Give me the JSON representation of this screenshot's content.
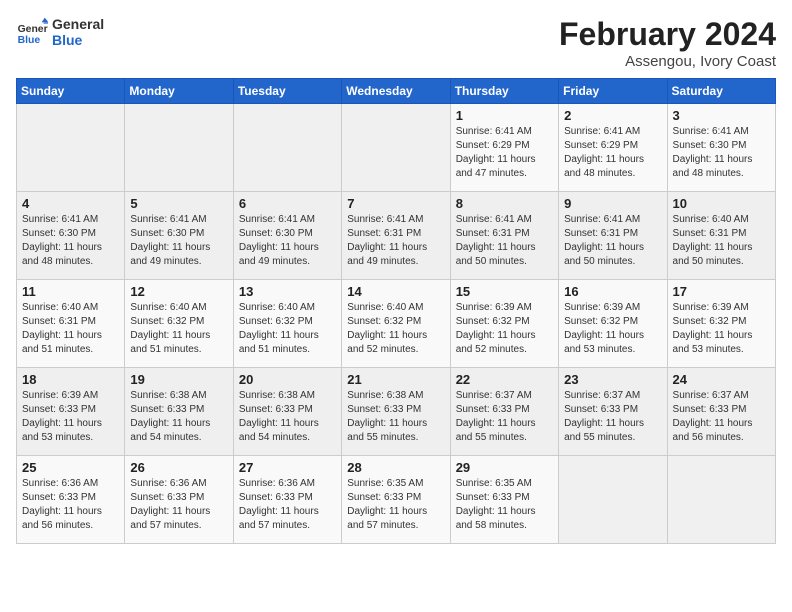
{
  "logo": {
    "line1": "General",
    "line2": "Blue"
  },
  "title": "February 2024",
  "subtitle": "Assengou, Ivory Coast",
  "days_header": [
    "Sunday",
    "Monday",
    "Tuesday",
    "Wednesday",
    "Thursday",
    "Friday",
    "Saturday"
  ],
  "weeks": [
    [
      {
        "day": "",
        "info": ""
      },
      {
        "day": "",
        "info": ""
      },
      {
        "day": "",
        "info": ""
      },
      {
        "day": "",
        "info": ""
      },
      {
        "day": "1",
        "info": "Sunrise: 6:41 AM\nSunset: 6:29 PM\nDaylight: 11 hours\nand 47 minutes."
      },
      {
        "day": "2",
        "info": "Sunrise: 6:41 AM\nSunset: 6:29 PM\nDaylight: 11 hours\nand 48 minutes."
      },
      {
        "day": "3",
        "info": "Sunrise: 6:41 AM\nSunset: 6:30 PM\nDaylight: 11 hours\nand 48 minutes."
      }
    ],
    [
      {
        "day": "4",
        "info": "Sunrise: 6:41 AM\nSunset: 6:30 PM\nDaylight: 11 hours\nand 48 minutes."
      },
      {
        "day": "5",
        "info": "Sunrise: 6:41 AM\nSunset: 6:30 PM\nDaylight: 11 hours\nand 49 minutes."
      },
      {
        "day": "6",
        "info": "Sunrise: 6:41 AM\nSunset: 6:30 PM\nDaylight: 11 hours\nand 49 minutes."
      },
      {
        "day": "7",
        "info": "Sunrise: 6:41 AM\nSunset: 6:31 PM\nDaylight: 11 hours\nand 49 minutes."
      },
      {
        "day": "8",
        "info": "Sunrise: 6:41 AM\nSunset: 6:31 PM\nDaylight: 11 hours\nand 50 minutes."
      },
      {
        "day": "9",
        "info": "Sunrise: 6:41 AM\nSunset: 6:31 PM\nDaylight: 11 hours\nand 50 minutes."
      },
      {
        "day": "10",
        "info": "Sunrise: 6:40 AM\nSunset: 6:31 PM\nDaylight: 11 hours\nand 50 minutes."
      }
    ],
    [
      {
        "day": "11",
        "info": "Sunrise: 6:40 AM\nSunset: 6:31 PM\nDaylight: 11 hours\nand 51 minutes."
      },
      {
        "day": "12",
        "info": "Sunrise: 6:40 AM\nSunset: 6:32 PM\nDaylight: 11 hours\nand 51 minutes."
      },
      {
        "day": "13",
        "info": "Sunrise: 6:40 AM\nSunset: 6:32 PM\nDaylight: 11 hours\nand 51 minutes."
      },
      {
        "day": "14",
        "info": "Sunrise: 6:40 AM\nSunset: 6:32 PM\nDaylight: 11 hours\nand 52 minutes."
      },
      {
        "day": "15",
        "info": "Sunrise: 6:39 AM\nSunset: 6:32 PM\nDaylight: 11 hours\nand 52 minutes."
      },
      {
        "day": "16",
        "info": "Sunrise: 6:39 AM\nSunset: 6:32 PM\nDaylight: 11 hours\nand 53 minutes."
      },
      {
        "day": "17",
        "info": "Sunrise: 6:39 AM\nSunset: 6:32 PM\nDaylight: 11 hours\nand 53 minutes."
      }
    ],
    [
      {
        "day": "18",
        "info": "Sunrise: 6:39 AM\nSunset: 6:33 PM\nDaylight: 11 hours\nand 53 minutes."
      },
      {
        "day": "19",
        "info": "Sunrise: 6:38 AM\nSunset: 6:33 PM\nDaylight: 11 hours\nand 54 minutes."
      },
      {
        "day": "20",
        "info": "Sunrise: 6:38 AM\nSunset: 6:33 PM\nDaylight: 11 hours\nand 54 minutes."
      },
      {
        "day": "21",
        "info": "Sunrise: 6:38 AM\nSunset: 6:33 PM\nDaylight: 11 hours\nand 55 minutes."
      },
      {
        "day": "22",
        "info": "Sunrise: 6:37 AM\nSunset: 6:33 PM\nDaylight: 11 hours\nand 55 minutes."
      },
      {
        "day": "23",
        "info": "Sunrise: 6:37 AM\nSunset: 6:33 PM\nDaylight: 11 hours\nand 55 minutes."
      },
      {
        "day": "24",
        "info": "Sunrise: 6:37 AM\nSunset: 6:33 PM\nDaylight: 11 hours\nand 56 minutes."
      }
    ],
    [
      {
        "day": "25",
        "info": "Sunrise: 6:36 AM\nSunset: 6:33 PM\nDaylight: 11 hours\nand 56 minutes."
      },
      {
        "day": "26",
        "info": "Sunrise: 6:36 AM\nSunset: 6:33 PM\nDaylight: 11 hours\nand 57 minutes."
      },
      {
        "day": "27",
        "info": "Sunrise: 6:36 AM\nSunset: 6:33 PM\nDaylight: 11 hours\nand 57 minutes."
      },
      {
        "day": "28",
        "info": "Sunrise: 6:35 AM\nSunset: 6:33 PM\nDaylight: 11 hours\nand 57 minutes."
      },
      {
        "day": "29",
        "info": "Sunrise: 6:35 AM\nSunset: 6:33 PM\nDaylight: 11 hours\nand 58 minutes."
      },
      {
        "day": "",
        "info": ""
      },
      {
        "day": "",
        "info": ""
      }
    ]
  ]
}
